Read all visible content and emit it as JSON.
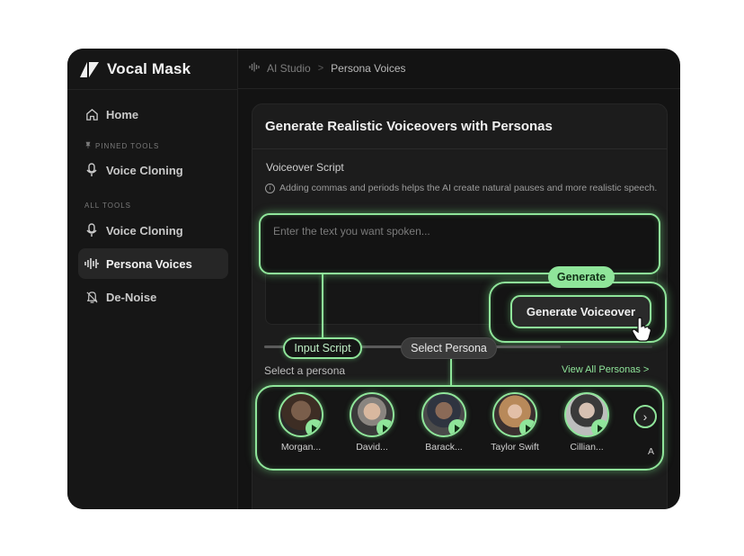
{
  "app": {
    "brand_name": "Vocal Mask",
    "breadcrumb": [
      "AI Studio",
      "Persona Voices"
    ],
    "breadcrumb_separator": ">"
  },
  "sidebar": {
    "home": "Home",
    "pinned_label": "PINNED TOOLS",
    "pinned_items": [
      {
        "label": "Voice Cloning",
        "icon": "microphone-icon"
      }
    ],
    "all_label": "ALL TOOLS",
    "items": [
      {
        "label": "Voice Cloning",
        "icon": "microphone-icon",
        "active": false
      },
      {
        "label": "Persona Voices",
        "icon": "waveform-icon",
        "active": true
      },
      {
        "label": "De-Noise",
        "icon": "noise-off-icon",
        "active": false
      }
    ]
  },
  "main": {
    "title": "Generate Realistic Voiceovers with Personas",
    "script_label": "Voiceover Script",
    "hint": "Adding commas and periods helps the AI create natural pauses and more realistic speech.",
    "script_placeholder": "Enter the text you want spoken...",
    "generate_button": "Generate Voiceover",
    "select_persona_label": "Select a persona",
    "view_all": "View All Personas >",
    "next_arrow": "›",
    "extra_persona_initial": "A"
  },
  "callouts": {
    "generate": "Generate",
    "input_script": "Input Script",
    "select_persona": "Select Persona"
  },
  "personas": [
    {
      "name": "Morgan..."
    },
    {
      "name": "David..."
    },
    {
      "name": "Barack..."
    },
    {
      "name": "Taylor Swift"
    },
    {
      "name": "Cillian..."
    }
  ],
  "colors": {
    "accent": "#8fe59a",
    "background": "#131313"
  }
}
